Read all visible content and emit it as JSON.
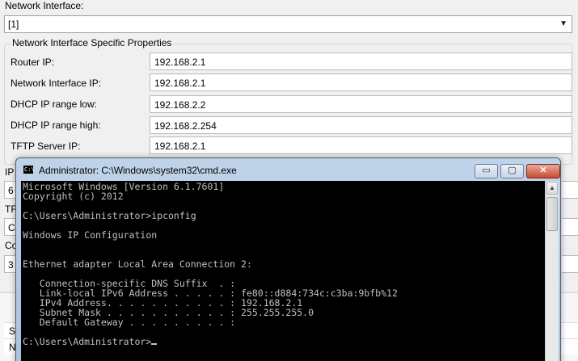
{
  "network_interface": {
    "label": "Network Interface:",
    "selected": "[1]",
    "dropdown_icon": "chevron-down-icon"
  },
  "specific_properties": {
    "title": "Network Interface Specific Properties",
    "rows": [
      {
        "label": "Router IP:",
        "value": "192.168.2.1"
      },
      {
        "label": "Network Interface IP:",
        "value": "192.168.2.1"
      },
      {
        "label": "DHCP IP range low:",
        "value": "192.168.2.2"
      },
      {
        "label": "DHCP IP range high:",
        "value": "192.168.2.254"
      },
      {
        "label": "TFTP Server IP:",
        "value": "192.168.2.1"
      }
    ]
  },
  "hidden_rows": {
    "label_1": "IP",
    "value_1": "6",
    "label_2": "TF",
    "value_2": "C",
    "label_3": "Co",
    "value_3": "3",
    "bottom_1": "S",
    "bottom_2": "N"
  },
  "cmd_window": {
    "title": "Administrator: C:\\Windows\\system32\\cmd.exe",
    "icon_text": "C:\\",
    "buttons": {
      "minimize": "▭",
      "maximize": "▢",
      "close": "✕"
    },
    "lines": [
      "Microsoft Windows [Version 6.1.7601]",
      "Copyright (c) 2012",
      "",
      "C:\\Users\\Administrator>ipconfig",
      "",
      "Windows IP Configuration",
      "",
      "",
      "Ethernet adapter Local Area Connection 2:",
      "",
      "   Connection-specific DNS Suffix  . :",
      "   Link-local IPv6 Address . . . . . : fe80::d884:734c:c3ba:9bfb%12",
      "   IPv4 Address. . . . . . . . . . . : 192.168.2.1",
      "   Subnet Mask . . . . . . . . . . . : 255.255.255.0",
      "   Default Gateway . . . . . . . . . :",
      "",
      "C:\\Users\\Administrator>"
    ]
  }
}
